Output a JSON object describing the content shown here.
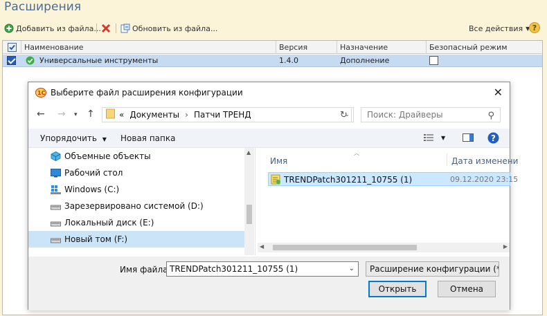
{
  "app": {
    "title": "Расширения"
  },
  "toolbar": {
    "add_label": "Добавить из файла...",
    "update_label": "Обновить из файла...",
    "all_actions_label": "Все действия",
    "help_label": "?"
  },
  "grid": {
    "columns": [
      "Наименование",
      "Версия",
      "Назначение",
      "Безопасный режим"
    ],
    "rows": [
      {
        "name": "Универсальные инструменты",
        "version": "1.4.0",
        "purpose": "Дополнение",
        "checked": true,
        "safe_mode": false
      }
    ]
  },
  "dialog": {
    "title": "Выберите файл расширения конфигурации",
    "breadcrumb": [
      "«",
      "Документы",
      "›",
      "Патчи ТРЕНД"
    ],
    "search_placeholder": "Поиск: Драйверы",
    "organize_label": "Упорядочить",
    "new_folder_label": "Новая папка",
    "tree_items": [
      {
        "label": "Объемные объекты",
        "icon": "3d-objects-icon"
      },
      {
        "label": "Рабочий стол",
        "icon": "desktop-icon"
      },
      {
        "label": "Windows (C:)",
        "icon": "windows-drive-icon"
      },
      {
        "label": "Зарезервировано системой (D:)",
        "icon": "drive-icon"
      },
      {
        "label": "Локальный диск (E:)",
        "icon": "drive-icon"
      },
      {
        "label": "Новый том (F:)",
        "icon": "drive-icon",
        "selected": true
      }
    ],
    "file_columns": {
      "name": "Имя",
      "date": "Дата изменени"
    },
    "files": [
      {
        "name": "TRENDPatch301211_10755 (1)",
        "date": "09.12.2020 23:15"
      }
    ],
    "filename_label": "Имя файла:",
    "filename_value": "TRENDPatch301211_10755 (1)",
    "filetype_value": "Расширение конфигурации (*",
    "open_label": "Открыть",
    "cancel_label": "Отмена"
  }
}
